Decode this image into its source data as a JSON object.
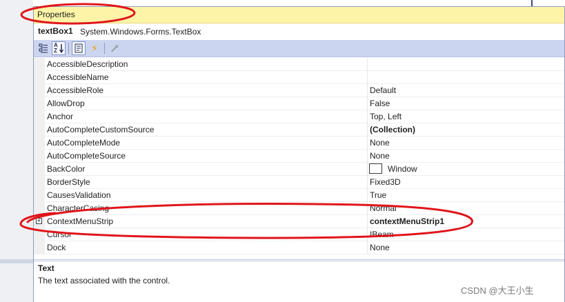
{
  "window": {
    "title": "Properties"
  },
  "object": {
    "name": "textBox1",
    "type": "System.Windows.Forms.TextBox"
  },
  "toolbar": {
    "buttons": [
      {
        "name": "categorized-button",
        "icon": "categorized-icon",
        "pressed": false
      },
      {
        "name": "alphabetical-button",
        "icon": "alphabetical-sort-icon",
        "pressed": true
      },
      {
        "name": "properties-button",
        "icon": "properties-page-icon",
        "pressed": true
      },
      {
        "name": "events-button",
        "icon": "lightning-bolt-icon",
        "pressed": false
      },
      {
        "name": "property-pages-button",
        "icon": "wrench-icon",
        "pressed": false
      }
    ],
    "az_glyph": "AZ",
    "bolt_glyph": "⚡"
  },
  "properties": [
    {
      "name": "AccessibleDescription",
      "value": ""
    },
    {
      "name": "AccessibleName",
      "value": ""
    },
    {
      "name": "AccessibleRole",
      "value": "Default"
    },
    {
      "name": "AllowDrop",
      "value": "False"
    },
    {
      "name": "Anchor",
      "value": "Top, Left"
    },
    {
      "name": "AutoCompleteCustomSource",
      "value": "(Collection)"
    },
    {
      "name": "AutoCompleteMode",
      "value": "None"
    },
    {
      "name": "AutoCompleteSource",
      "value": "None"
    },
    {
      "name": "BackColor",
      "value": "Window"
    },
    {
      "name": "BorderStyle",
      "value": "Fixed3D"
    },
    {
      "name": "CausesValidation",
      "value": "True"
    },
    {
      "name": "CharacterCasing",
      "value": "Normal"
    },
    {
      "name": "ContextMenuStrip",
      "value": "contextMenuStrip1"
    },
    {
      "name": "Cursor",
      "value": "IBeam"
    },
    {
      "name": "Dock",
      "value": "None"
    }
  ],
  "expand_glyph": "+",
  "description": {
    "title": "Text",
    "text": "The text associated with the control."
  },
  "watermark": "CSDN @大王小生",
  "colors": {
    "titlebar": "#fdf4a8",
    "toolbar": "#ccd5f0",
    "annotation": "#e0151b"
  }
}
